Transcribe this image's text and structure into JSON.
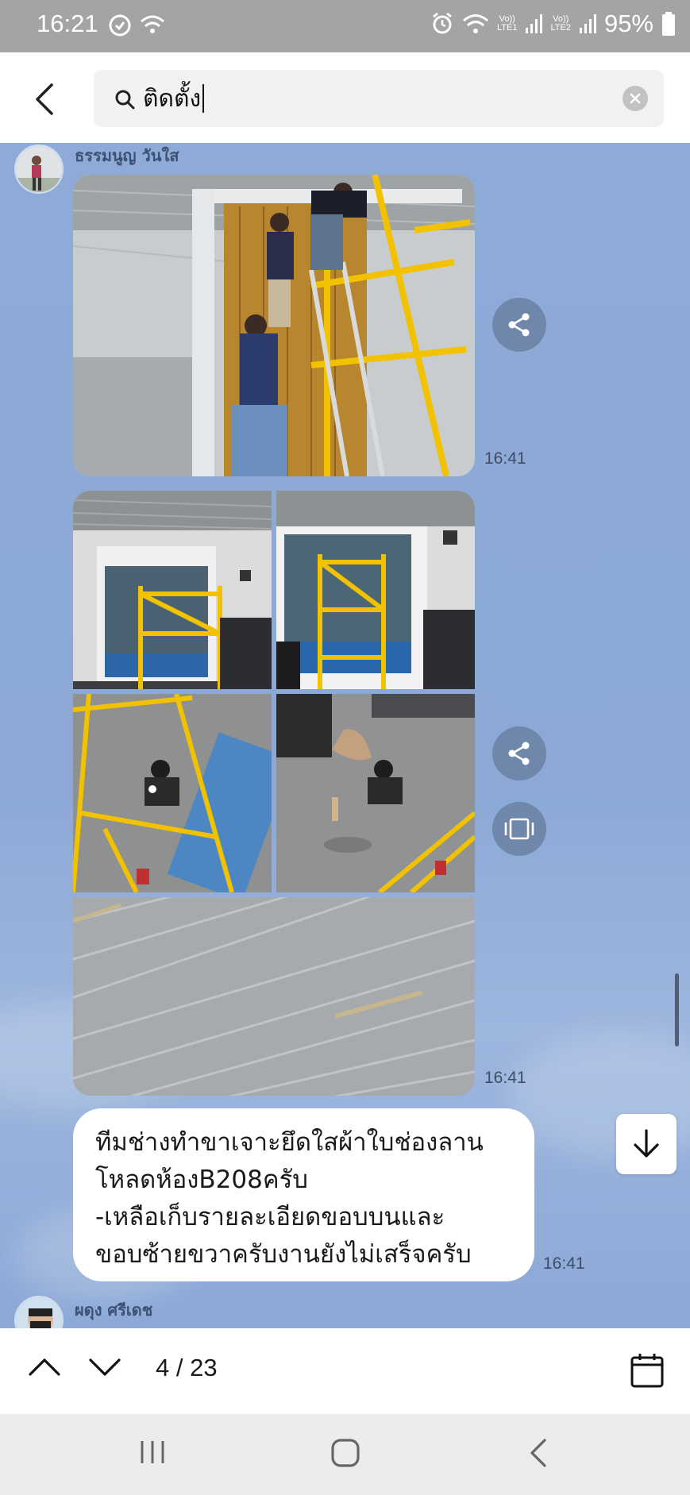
{
  "status_bar": {
    "time": "16:21",
    "sim1_label": "Vo))\nLTE1",
    "sim2_label": "Vo))\nLTE2",
    "battery": "95%"
  },
  "search": {
    "query": "ติดตั้ง"
  },
  "messages": [
    {
      "sender": "ธรรมนูญ วันใส",
      "time_1": "16:41",
      "time_2": "16:41",
      "text_lines": [
        "ทีมช่างทำขาเจาะยึดใสผ้าใบช่องลาน",
        "โหลดห้องB208ครับ",
        "-เหลือเก็บรายละเอียดขอบบนและ",
        "ขอบซ้ายขวาครับงานยังไม่เสร็จครับ"
      ],
      "text_time": "16:41"
    },
    {
      "sender": "ผดุง ศรีเดช"
    }
  ],
  "navigation": {
    "counter": "4 / 23"
  },
  "colors": {
    "chat_background": "#8eabd8",
    "action_button": "#7087ac",
    "sender_text": "#3d5175"
  },
  "icons": [
    "back-arrow-icon",
    "search-icon",
    "clear-icon",
    "share-icon",
    "carousel-icon",
    "arrow-down-icon",
    "chevron-up-icon",
    "chevron-down-icon",
    "calendar-icon",
    "recents-icon",
    "home-icon",
    "system-back-icon"
  ]
}
